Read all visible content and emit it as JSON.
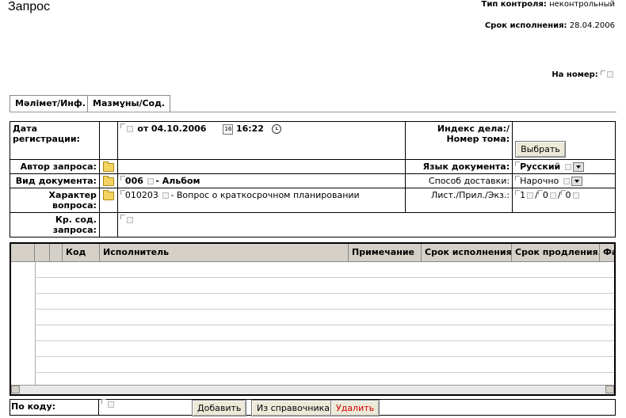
{
  "header": {
    "title": "Запрос",
    "control_type_label": "Тип контроля:",
    "control_type_value": "неконтрольный",
    "deadline_label": "Срок исполнения:",
    "deadline_value": "28.04.2006",
    "number_label": "На номер:"
  },
  "tabs": [
    {
      "label": "Мәлімет/Инф."
    },
    {
      "label": "Мазмұны/Сод."
    }
  ],
  "form": {
    "reg_date_label": "Дата регистрации:",
    "reg_date_prefix": "от",
    "reg_date_value": "04.10.2006",
    "cal_icon_text": "16",
    "reg_time_value": "16:22",
    "case_index_label": "Индекс дела:/Номер тома:",
    "choose_button": "Выбрать",
    "author_label": "Автор запроса:",
    "doc_lang_label": "Язык документа:",
    "doc_lang_value": "Русский",
    "doc_type_label": "Вид документа:",
    "doc_type_code": "006",
    "doc_type_name": "- Альбом",
    "delivery_label": "Способ доставки:",
    "delivery_value": "Нарочно",
    "question_label": "Характер вопроса:",
    "question_code": "010203",
    "question_name": "- Вопрос о краткосрочном планировании",
    "sheets_label": "Лист./Прил./Экз.:",
    "sheets_v1": "1",
    "sheets_v2": "0",
    "sheets_v3": "0",
    "summary_label": "Кр. сод. запроса:"
  },
  "grid": {
    "columns": [
      "Код",
      "Исполнитель",
      "Примечание",
      "Срок исполнения",
      "Срок продления.",
      "Фа"
    ]
  },
  "footer": {
    "by_code_label": "По коду:",
    "add_button": "Добавить",
    "from_dict_button": "Из справочника",
    "delete_button": "Удалить"
  },
  "colors": {
    "delete_text": "#d40000",
    "grid_header": "#d4d0c8"
  }
}
